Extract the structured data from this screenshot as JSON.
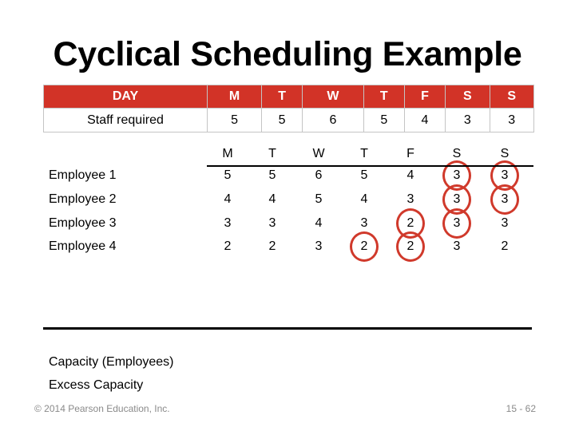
{
  "title": "Cyclical Scheduling Example",
  "requirements_table": {
    "header_label": "DAY",
    "days": [
      "M",
      "T",
      "W",
      "T",
      "F",
      "S",
      "S"
    ],
    "row_label": "Staff required",
    "values": [
      "5",
      "5",
      "6",
      "5",
      "4",
      "3",
      "3"
    ],
    "header_color": "#d23327"
  },
  "schedule": {
    "days": [
      "M",
      "T",
      "W",
      "T",
      "F",
      "S",
      "S"
    ],
    "rows": [
      {
        "label": "Employee 1",
        "values": [
          "5",
          "5",
          "6",
          "5",
          "4",
          "3",
          "3"
        ],
        "circled": [
          5,
          6
        ]
      },
      {
        "label": "Employee 2",
        "values": [
          "4",
          "4",
          "5",
          "4",
          "3",
          "3",
          "3"
        ],
        "circled": [
          5,
          6
        ]
      },
      {
        "label": "Employee 3",
        "values": [
          "3",
          "3",
          "4",
          "3",
          "2",
          "3",
          "3"
        ],
        "circled": [
          4,
          5
        ]
      },
      {
        "label": "Employee 4",
        "values": [
          "2",
          "2",
          "3",
          "2",
          "2",
          "3",
          "2"
        ],
        "circled": [
          3,
          4
        ]
      }
    ],
    "circle_color": "#d0392b"
  },
  "summary": {
    "capacity_label": "Capacity (Employees)",
    "excess_label": "Excess Capacity"
  },
  "footer": {
    "copyright": "© 2014 Pearson Education, Inc.",
    "page": "15 - 62"
  }
}
